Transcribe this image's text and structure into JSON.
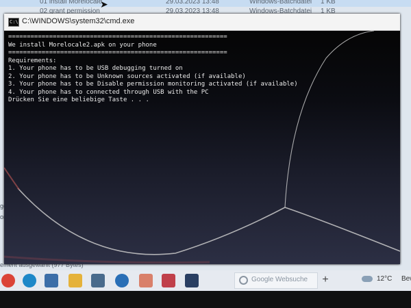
{
  "explorer": {
    "files": [
      {
        "name": "01 install Morelocale",
        "date": "29.03.2023 13:48",
        "type": "Windows-Batchdatei",
        "size": "1 KB"
      },
      {
        "name": "02 grant permission",
        "date": "29.03.2023 13:48",
        "type": "Windows-Batchdatei",
        "size": "1 KB"
      }
    ],
    "left_fragments": [
      "gen",
      "on"
    ],
    "status_text": "ement ausgewählt (977 Bytes)"
  },
  "cmd": {
    "title": "C:\\WINDOWS\\system32\\cmd.exe",
    "lines": [
      "===========================================================",
      "We install Morelocale2.apk on your phone",
      "===========================================================",
      "Requirements:",
      "1. Your phone has to be USB debugging turned on",
      "2. Your phone has to be Unknown sources activated (if available)",
      "3. Your phone has to be Disable permission monitoring activated (if available)",
      "4. Your phone has to connected through USB with the PC",
      "Drücken Sie eine beliebige Taste . . ."
    ]
  },
  "taskbar": {
    "icons": [
      {
        "name": "chrome-icon",
        "color": "#db4437"
      },
      {
        "name": "edge-icon",
        "color": "#1e88c8"
      },
      {
        "name": "app-icon",
        "color": "#3c6ea8"
      },
      {
        "name": "file-explorer-icon",
        "color": "#e5b23a"
      },
      {
        "name": "remote-desktop-icon",
        "color": "#4a6b8c"
      },
      {
        "name": "network-app-icon",
        "color": "#2a6fb6"
      },
      {
        "name": "app-icon",
        "color": "#d9806a"
      },
      {
        "name": "photos-icon",
        "color": "#c0404a"
      },
      {
        "name": "screen-icon",
        "color": "#2a3f62"
      }
    ],
    "search_placeholder": "Google Websuche",
    "new_tab": "+",
    "weather_temp": "12°C",
    "weather_desc": "Bewöl"
  }
}
